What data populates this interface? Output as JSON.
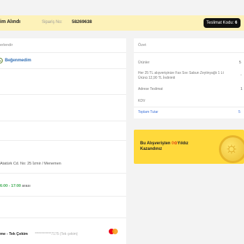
{
  "banner": {
    "title": "im Alındı",
    "order_label": "Sipariş No:",
    "order_number": "58269638",
    "delivery_code_label": "Teslimat Kodu:",
    "delivery_code_value": "6"
  },
  "left": {
    "rate_heading": "erlendir",
    "dislike_label": "Beğenmedim",
    "address": "Atatürk Cd. No: 25 İzmir / Menemen",
    "delivery_time": "6:00 - 17:00",
    "delivery_suffix": "arası",
    "payment_method": "me - Tek Çekim",
    "card_number": "************7175 (Tek çekim)",
    "card_icon": "mastercard-icon"
  },
  "summary": {
    "heading": "Özet",
    "products_label": "Ürünler",
    "products_value": "5",
    "discount_text_1": "Her 25 TL alışverişinize Fax Sıvı Sabun Zeytinyağlı 1 Lt",
    "discount_text_2": "Ürünü 12,90 TL İndirimli",
    "discount_value": "-",
    "shipping_label": "Adrese Teslimat",
    "shipping_value": "1",
    "tax_label": "KDV",
    "total_label": "Toplam Tutar",
    "total_value": "5"
  },
  "promo": {
    "text_1": "Bu Alışverişten",
    "text_2": "Kazandınız",
    "coin_value": "0",
    "coin_name": "Yıldız"
  }
}
